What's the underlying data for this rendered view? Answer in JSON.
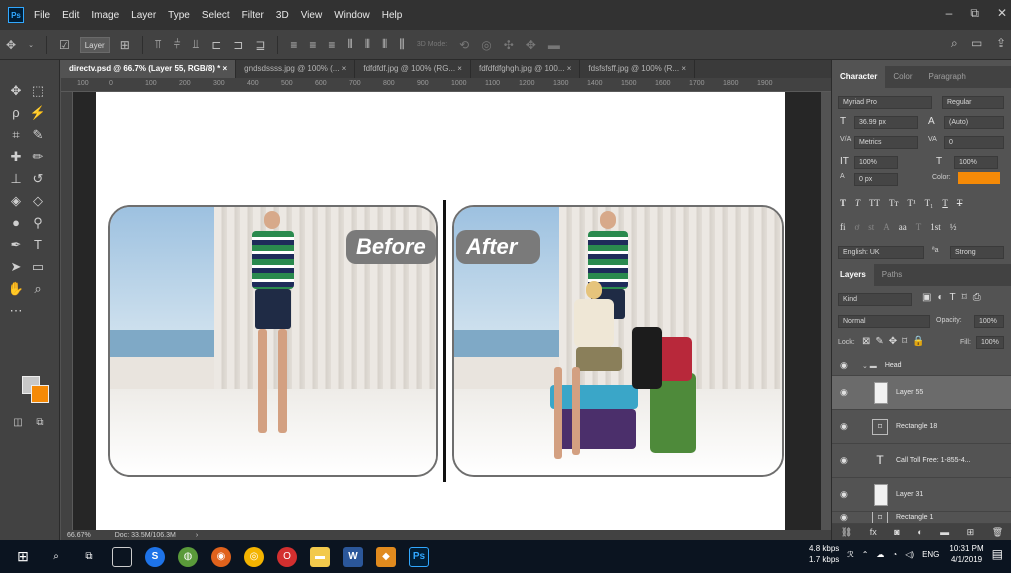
{
  "app": {
    "logo": "Ps"
  },
  "menu": [
    "File",
    "Edit",
    "Image",
    "Layer",
    "Type",
    "Select",
    "Filter",
    "3D",
    "View",
    "Window",
    "Help"
  ],
  "window_controls": [
    "–",
    "⧉",
    "✕"
  ],
  "options_bar": {
    "auto_select": "Layer",
    "mode_3d": "3D Mode:"
  },
  "doc_tabs": [
    "directv.psd @ 66.7% (Layer 55, RGB/8) *",
    "gndsdssss.jpg @ 100% (...",
    "fdfdfdf.jpg @ 100% (RG...",
    "fdfdfdfghgh.jpg @ 100...",
    "fdsfsfsff.jpg @ 100% (R..."
  ],
  "ruler_h": [
    "100",
    "0",
    "100",
    "200",
    "300",
    "400",
    "500",
    "600",
    "700",
    "800",
    "900",
    "1000",
    "1100",
    "1200",
    "1300",
    "1400",
    "1500",
    "1600",
    "1700",
    "1800",
    "1900"
  ],
  "canvas": {
    "before_label": "Before",
    "after_label": "After"
  },
  "status": {
    "zoom": "66.67%",
    "doc": "Doc: 33.5M/106.3M"
  },
  "character_panel": {
    "tabs": [
      "Character",
      "Color",
      "Paragraph"
    ],
    "font_family": "Myriad Pro",
    "font_style": "Regular",
    "font_size": "36.99 px",
    "leading": "(Auto)",
    "kerning": "Metrics",
    "tracking": "0",
    "vertical_scale": "100%",
    "horizontal_scale": "100%",
    "baseline_shift": "0 px",
    "color_label": "Color:",
    "color": "#f58a07",
    "language": "English: UK",
    "antialias": "Strong",
    "aa_label": "ªa"
  },
  "layers_panel": {
    "tabs": [
      "Layers",
      "Paths"
    ],
    "filter": "Kind",
    "blend_mode": "Normal",
    "opacity_label": "Opacity:",
    "opacity": "100%",
    "lock_label": "Lock:",
    "fill_label": "Fill:",
    "fill": "100%",
    "layers": [
      {
        "name": "Head",
        "type": "group"
      },
      {
        "name": "Layer 55",
        "type": "pixel",
        "selected": true
      },
      {
        "name": "Rectangle 18",
        "type": "shape"
      },
      {
        "name": "Call Toll Free: 1-855-4...",
        "type": "text"
      },
      {
        "name": "Layer 31",
        "type": "pixel"
      },
      {
        "name": "Rectangle 1",
        "type": "shape"
      }
    ]
  },
  "taskbar": {
    "net_down": "4.8 kbps",
    "net_up": "1.7 kbps",
    "lang": "ENG",
    "time": "10:31 PM",
    "date": "4/1/2019"
  }
}
